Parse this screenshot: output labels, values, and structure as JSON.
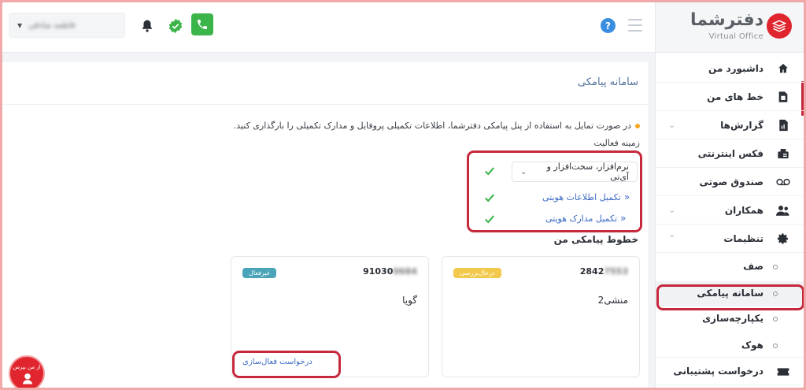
{
  "header": {
    "user_name": "فاطمه صادقی",
    "help_label": "?"
  },
  "sidebar": {
    "logo_title": "دفترشما",
    "logo_subtitle": "Virtual Office",
    "items": [
      {
        "label": "داشبورد من",
        "icon": "home-icon"
      },
      {
        "label": "خط های من",
        "icon": "sim-card-icon"
      },
      {
        "label": "گزارش‌ها",
        "icon": "report-icon"
      },
      {
        "label": "فکس اینترنتی",
        "icon": "fax-icon"
      },
      {
        "label": "صندوق صوتی",
        "icon": "voicemail-icon"
      },
      {
        "label": "همکاران",
        "icon": "users-icon"
      },
      {
        "label": "تنظیمات",
        "icon": "gear-icon"
      }
    ],
    "sub_items": [
      {
        "label": "صف"
      },
      {
        "label": "سامانه پیامکی"
      },
      {
        "label": "یکپارچه‌سازی"
      },
      {
        "label": "هوک"
      }
    ],
    "last_item": {
      "label": "درخواست پشتیبانی",
      "icon": "ticket-icon"
    }
  },
  "main": {
    "title": "سامانه پیامکی",
    "info_text": "در صورت تمایل به استفاده از پنل پیامکی دفترشما، اطلاعات تکمیلی پروفایل و مدارک تکمیلی را بارگذاری کنید.",
    "activity_label": "زمینه فعالیت",
    "activity_value": "نرم‌افزار، سخت‌افزار و آی‌تی",
    "link_identity": "تکمیل اطلاعات هویتی",
    "link_documents": "تکمیل مدارک هویتی",
    "lines_title": "خطوط پیامکی من",
    "lines": [
      {
        "number_visible": "2842",
        "number_hidden": "7553",
        "name": "منشی2",
        "badge": "درحال‌بررسی",
        "badge_color": "#f2c94c"
      },
      {
        "number_visible": "91030",
        "number_hidden": "0684",
        "name": "گویا",
        "badge": "غیرفعال",
        "badge_color": "#4aa3b8",
        "action": "درخواست فعال‌سازی"
      }
    ]
  },
  "support_button": {
    "label": "از من بپرس"
  },
  "colors": {
    "accent_red": "#c6283c",
    "brand_red": "#e0252f",
    "link_blue": "#3d6bc4",
    "success_green": "#3bb54a"
  }
}
